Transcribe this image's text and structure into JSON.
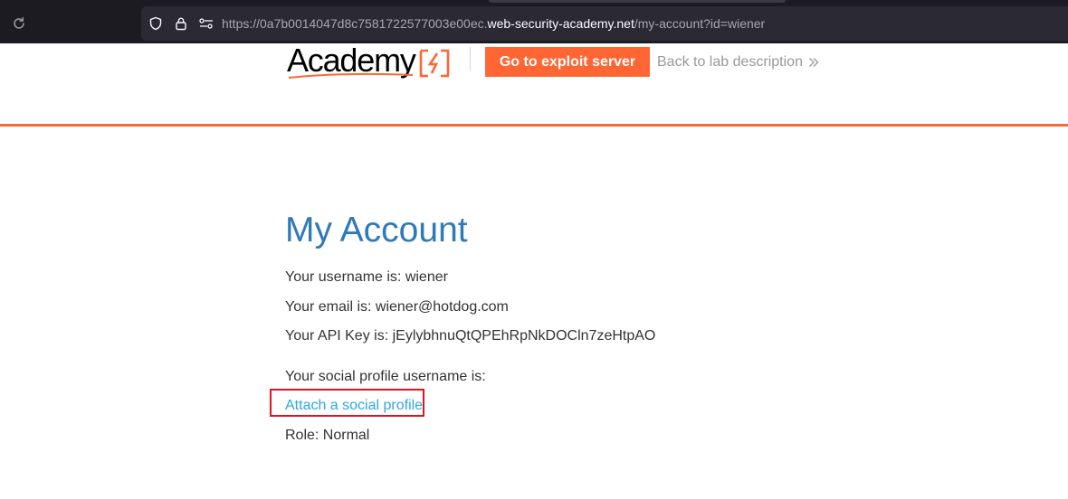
{
  "browser": {
    "url_prefix": "https://0a7b0014047d8c7581722577003e00ec.",
    "url_host": "web-security-academy.net",
    "url_path": "/my-account?id=wiener"
  },
  "header": {
    "logo_text": "Academy",
    "exploit_button": "Go to exploit server",
    "back_link": "Back to lab description"
  },
  "account": {
    "title": "My Account",
    "username_line": "Your username is: wiener",
    "email_line": "Your email is: wiener@hotdog.com",
    "apikey_line": "Your API Key is: jEylybhnuQtQPEhRpNkDOCln7zeHtpAO",
    "social_line": "Your social profile username is:",
    "social_link": "Attach a social profile",
    "role_line": "Role: Normal"
  },
  "colors": {
    "accent": "#ff6633",
    "title": "#2e7ab8",
    "link": "#29a9e1",
    "highlight": "#e0141e"
  },
  "icons": [
    "reload-icon",
    "shield-icon",
    "lock-icon",
    "permissions-icon",
    "academy-logo-icon",
    "double-chevron-right-icon"
  ]
}
